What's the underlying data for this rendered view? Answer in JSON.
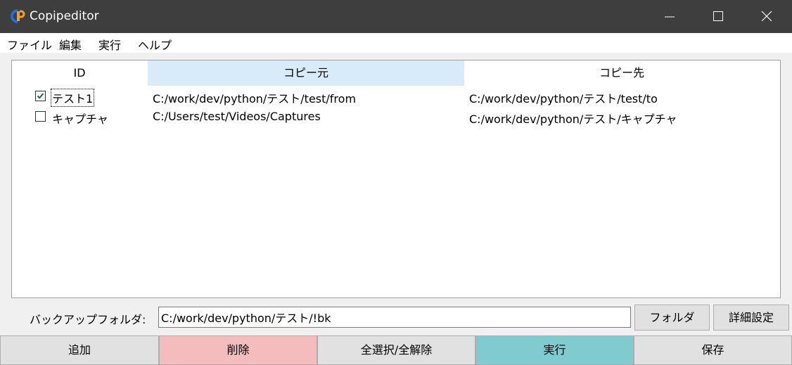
{
  "window": {
    "title": "Copipeditor",
    "icon": "app-logo-icon",
    "controls": [
      "minimize-icon",
      "maximize-icon",
      "close-icon"
    ]
  },
  "menu": [
    "ファイル",
    "編集",
    "実行",
    "ヘルプ"
  ],
  "table": {
    "headers": {
      "id": "ID",
      "src": "コピー元",
      "dst": "コピー先"
    },
    "rows": [
      {
        "checked": true,
        "id": "テスト1",
        "src": "C:/work/dev/python/テスト/test/from",
        "dst": "C:/work/dev/python/テスト/test/to"
      },
      {
        "checked": false,
        "id": "キャプチャ",
        "src": "C:/Users/test/Videos/Captures",
        "dst": "C:/work/dev/python/テスト/キャプチャ"
      }
    ]
  },
  "backup": {
    "label": "バックアップフォルダ:",
    "value": "C:/work/dev/python/テスト/!bk",
    "folder_button": "フォルダ",
    "detail_button": "詳細設定"
  },
  "actions": {
    "add": "追加",
    "delete": "削除",
    "select_all": "全選択/全解除",
    "run": "実行",
    "save": "保存"
  },
  "colors": {
    "titlebar": "#3e3e3e",
    "header_highlight": "#d9ebf9",
    "delete": "#f4bcbc",
    "run": "#80cbcf",
    "logo_blue": "#1e6fd9",
    "logo_orange": "#f0a030"
  }
}
